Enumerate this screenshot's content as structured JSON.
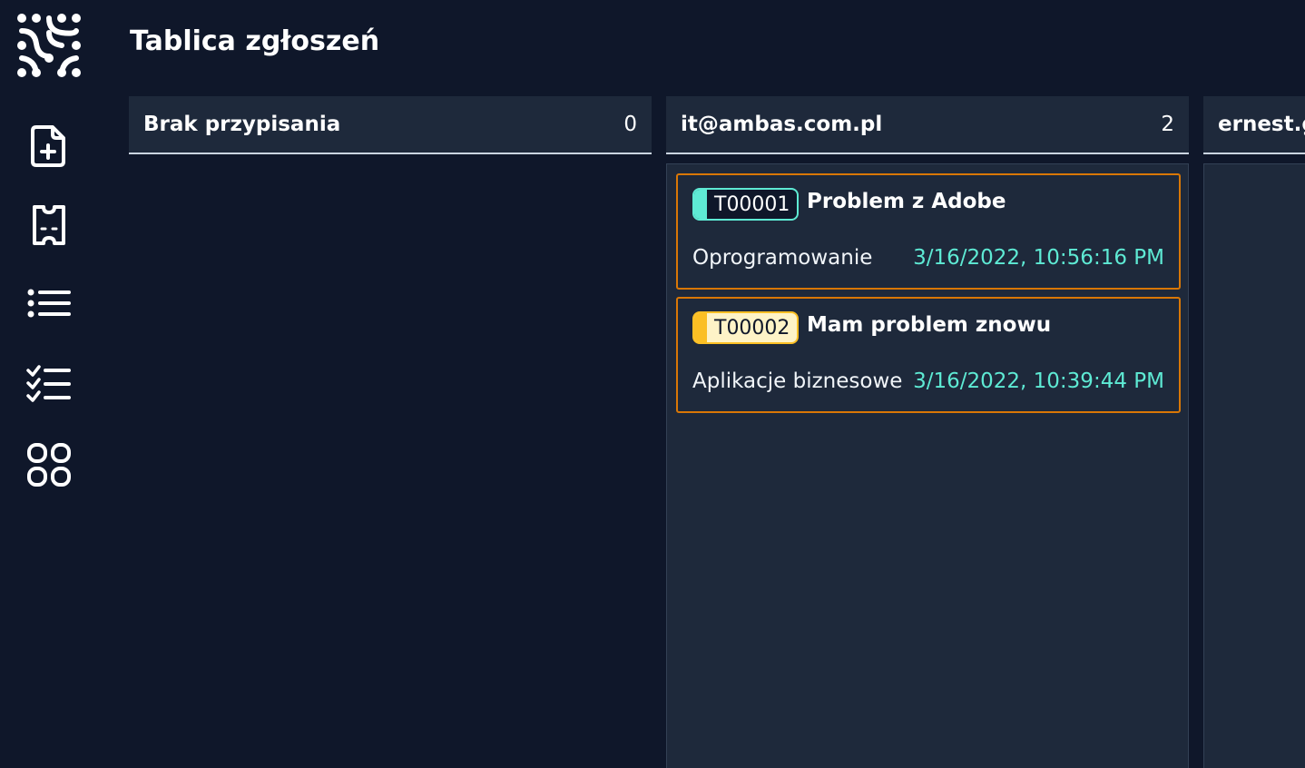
{
  "header": {
    "title": "Tablica zgłoszeń"
  },
  "sidebar": {
    "logo": "logo-icon",
    "items": [
      {
        "icon": "file-plus-icon"
      },
      {
        "icon": "ticket-icon"
      },
      {
        "icon": "list-icon"
      },
      {
        "icon": "checklist-icon"
      },
      {
        "icon": "grid-icon"
      }
    ]
  },
  "columns": [
    {
      "title": "Brak przypisania",
      "count": "0",
      "tickets": []
    },
    {
      "title": "it@ambas.com.pl",
      "count": "2",
      "tickets": [
        {
          "id": "T00001",
          "title": "Problem z Adobe",
          "category": "Oprogramowanie",
          "date": "3/16/2022, 10:56:16 PM",
          "priority_color": "#5eead4",
          "priority_bg": "#0f172a",
          "id_text_color": "#ffffff"
        },
        {
          "id": "T00002",
          "title": "Mam problem znowu",
          "category": "Aplikacje biznesowe",
          "date": "3/16/2022, 10:39:44 PM",
          "priority_color": "#fbbf24",
          "priority_bg": "#fef3c7",
          "id_text_color": "#0f172a"
        }
      ]
    },
    {
      "title": "ernest.g",
      "count": "",
      "tickets": []
    }
  ],
  "colors": {
    "background": "#0f172a",
    "panel": "#1e293b",
    "ticket_border": "#d97706",
    "date_text": "#5eead4"
  }
}
